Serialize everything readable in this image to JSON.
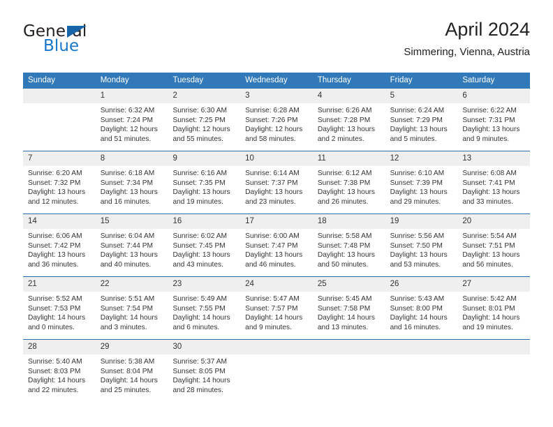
{
  "brand": {
    "name_part1": "General",
    "name_part2": "Blue",
    "triangle_color": "#1565a8",
    "blue_color": "#1877c9"
  },
  "header": {
    "title": "April 2024",
    "subtitle": "Simmering, Vienna, Austria"
  },
  "theme": {
    "header_row_bg": "#3179b8",
    "header_row_text": "#ffffff",
    "week_divider": "#2a6ba8",
    "day_number_bg": "#efefef",
    "body_text": "#333333"
  },
  "calendar": {
    "weekday_headers": [
      "Sunday",
      "Monday",
      "Tuesday",
      "Wednesday",
      "Thursday",
      "Friday",
      "Saturday"
    ],
    "weeks": [
      [
        {
          "day": "",
          "lines": []
        },
        {
          "day": "1",
          "lines": [
            "Sunrise: 6:32 AM",
            "Sunset: 7:24 PM",
            "Daylight: 12 hours",
            "and 51 minutes."
          ]
        },
        {
          "day": "2",
          "lines": [
            "Sunrise: 6:30 AM",
            "Sunset: 7:25 PM",
            "Daylight: 12 hours",
            "and 55 minutes."
          ]
        },
        {
          "day": "3",
          "lines": [
            "Sunrise: 6:28 AM",
            "Sunset: 7:26 PM",
            "Daylight: 12 hours",
            "and 58 minutes."
          ]
        },
        {
          "day": "4",
          "lines": [
            "Sunrise: 6:26 AM",
            "Sunset: 7:28 PM",
            "Daylight: 13 hours",
            "and 2 minutes."
          ]
        },
        {
          "day": "5",
          "lines": [
            "Sunrise: 6:24 AM",
            "Sunset: 7:29 PM",
            "Daylight: 13 hours",
            "and 5 minutes."
          ]
        },
        {
          "day": "6",
          "lines": [
            "Sunrise: 6:22 AM",
            "Sunset: 7:31 PM",
            "Daylight: 13 hours",
            "and 9 minutes."
          ]
        }
      ],
      [
        {
          "day": "7",
          "lines": [
            "Sunrise: 6:20 AM",
            "Sunset: 7:32 PM",
            "Daylight: 13 hours",
            "and 12 minutes."
          ]
        },
        {
          "day": "8",
          "lines": [
            "Sunrise: 6:18 AM",
            "Sunset: 7:34 PM",
            "Daylight: 13 hours",
            "and 16 minutes."
          ]
        },
        {
          "day": "9",
          "lines": [
            "Sunrise: 6:16 AM",
            "Sunset: 7:35 PM",
            "Daylight: 13 hours",
            "and 19 minutes."
          ]
        },
        {
          "day": "10",
          "lines": [
            "Sunrise: 6:14 AM",
            "Sunset: 7:37 PM",
            "Daylight: 13 hours",
            "and 23 minutes."
          ]
        },
        {
          "day": "11",
          "lines": [
            "Sunrise: 6:12 AM",
            "Sunset: 7:38 PM",
            "Daylight: 13 hours",
            "and 26 minutes."
          ]
        },
        {
          "day": "12",
          "lines": [
            "Sunrise: 6:10 AM",
            "Sunset: 7:39 PM",
            "Daylight: 13 hours",
            "and 29 minutes."
          ]
        },
        {
          "day": "13",
          "lines": [
            "Sunrise: 6:08 AM",
            "Sunset: 7:41 PM",
            "Daylight: 13 hours",
            "and 33 minutes."
          ]
        }
      ],
      [
        {
          "day": "14",
          "lines": [
            "Sunrise: 6:06 AM",
            "Sunset: 7:42 PM",
            "Daylight: 13 hours",
            "and 36 minutes."
          ]
        },
        {
          "day": "15",
          "lines": [
            "Sunrise: 6:04 AM",
            "Sunset: 7:44 PM",
            "Daylight: 13 hours",
            "and 40 minutes."
          ]
        },
        {
          "day": "16",
          "lines": [
            "Sunrise: 6:02 AM",
            "Sunset: 7:45 PM",
            "Daylight: 13 hours",
            "and 43 minutes."
          ]
        },
        {
          "day": "17",
          "lines": [
            "Sunrise: 6:00 AM",
            "Sunset: 7:47 PM",
            "Daylight: 13 hours",
            "and 46 minutes."
          ]
        },
        {
          "day": "18",
          "lines": [
            "Sunrise: 5:58 AM",
            "Sunset: 7:48 PM",
            "Daylight: 13 hours",
            "and 50 minutes."
          ]
        },
        {
          "day": "19",
          "lines": [
            "Sunrise: 5:56 AM",
            "Sunset: 7:50 PM",
            "Daylight: 13 hours",
            "and 53 minutes."
          ]
        },
        {
          "day": "20",
          "lines": [
            "Sunrise: 5:54 AM",
            "Sunset: 7:51 PM",
            "Daylight: 13 hours",
            "and 56 minutes."
          ]
        }
      ],
      [
        {
          "day": "21",
          "lines": [
            "Sunrise: 5:52 AM",
            "Sunset: 7:53 PM",
            "Daylight: 14 hours",
            "and 0 minutes."
          ]
        },
        {
          "day": "22",
          "lines": [
            "Sunrise: 5:51 AM",
            "Sunset: 7:54 PM",
            "Daylight: 14 hours",
            "and 3 minutes."
          ]
        },
        {
          "day": "23",
          "lines": [
            "Sunrise: 5:49 AM",
            "Sunset: 7:55 PM",
            "Daylight: 14 hours",
            "and 6 minutes."
          ]
        },
        {
          "day": "24",
          "lines": [
            "Sunrise: 5:47 AM",
            "Sunset: 7:57 PM",
            "Daylight: 14 hours",
            "and 9 minutes."
          ]
        },
        {
          "day": "25",
          "lines": [
            "Sunrise: 5:45 AM",
            "Sunset: 7:58 PM",
            "Daylight: 14 hours",
            "and 13 minutes."
          ]
        },
        {
          "day": "26",
          "lines": [
            "Sunrise: 5:43 AM",
            "Sunset: 8:00 PM",
            "Daylight: 14 hours",
            "and 16 minutes."
          ]
        },
        {
          "day": "27",
          "lines": [
            "Sunrise: 5:42 AM",
            "Sunset: 8:01 PM",
            "Daylight: 14 hours",
            "and 19 minutes."
          ]
        }
      ],
      [
        {
          "day": "28",
          "lines": [
            "Sunrise: 5:40 AM",
            "Sunset: 8:03 PM",
            "Daylight: 14 hours",
            "and 22 minutes."
          ]
        },
        {
          "day": "29",
          "lines": [
            "Sunrise: 5:38 AM",
            "Sunset: 8:04 PM",
            "Daylight: 14 hours",
            "and 25 minutes."
          ]
        },
        {
          "day": "30",
          "lines": [
            "Sunrise: 5:37 AM",
            "Sunset: 8:05 PM",
            "Daylight: 14 hours",
            "and 28 minutes."
          ]
        },
        {
          "day": "",
          "lines": []
        },
        {
          "day": "",
          "lines": []
        },
        {
          "day": "",
          "lines": []
        },
        {
          "day": "",
          "lines": []
        }
      ]
    ]
  }
}
